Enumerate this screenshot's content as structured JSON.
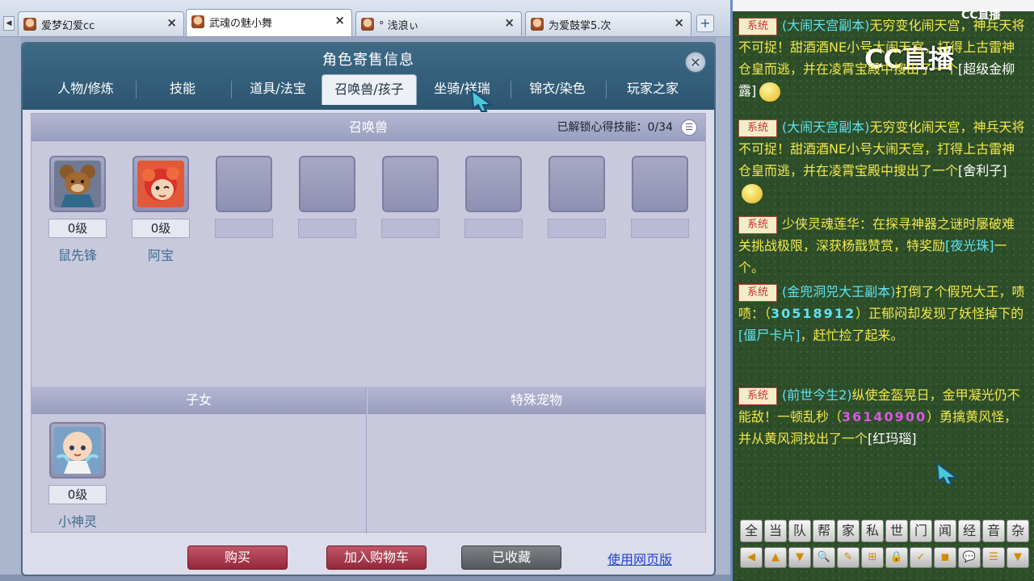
{
  "browser": {
    "tabs": [
      {
        "label": "爱梦幻爱cc",
        "close": "×"
      },
      {
        "label": "武魂の魅小舞",
        "close": "×"
      },
      {
        "label": "°  浅浪ぃ",
        "close": "×"
      },
      {
        "label": "为爱鼓掌5.次",
        "close": "×"
      }
    ],
    "add_tab": "+",
    "scroll_left": "◀"
  },
  "dialog": {
    "title": "角色寄售信息",
    "close": "✕",
    "tabs": [
      "人物/修炼",
      "技能",
      "道具/法宝",
      "召唤兽/孩子",
      "坐骑/祥瑞",
      "锦衣/染色",
      "玩家之家"
    ],
    "active_tab": "召唤兽/孩子",
    "summon_section": {
      "title": "召唤兽",
      "unlock_label": "已解锁心得技能：",
      "unlock_value": "0/34",
      "pets": [
        {
          "level": "0级",
          "name": "鼠先锋"
        },
        {
          "level": "0级",
          "name": "阿宝"
        }
      ],
      "empty_slots": 6
    },
    "children_section": {
      "title": "子女",
      "children": [
        {
          "level": "0级",
          "name": "小神灵"
        }
      ]
    },
    "special_section": {
      "title": "特殊宠物"
    },
    "buttons": {
      "buy": "购买",
      "add_cart": "加入购物车",
      "favorited": "已收藏",
      "web_version": "使用网页版"
    }
  },
  "chat": {
    "watermark_small": "CC直播",
    "watermark_big": "CC直播",
    "sys_tag": "系统",
    "messages": [
      {
        "parts": [
          {
            "t": "(大闹天宫副本)",
            "c": "cyan"
          },
          {
            "t": "无穷变化闹天宫，神兵天将不可捉！甜酒酒NE小号大闹天宫，打得上古雷神仓皇而逃，并在凌霄宝殿中搜出了一个",
            "c": ""
          },
          {
            "t": "[超级金柳露]",
            "c": "white"
          }
        ]
      },
      {
        "parts": [
          {
            "t": "(大闹天宫副本)",
            "c": "cyan"
          },
          {
            "t": "无穷变化闹天宫，神兵天将不可捉！甜酒酒NE小号大闹天宫，打得上古雷神仓皇而逃，并在凌霄宝殿中搜出了一个",
            "c": ""
          },
          {
            "t": "[舍利子]",
            "c": "white"
          }
        ]
      },
      {
        "parts": [
          {
            "t": "少侠灵魂莲华：在探寻神器之谜时屡破难关挑战极限，深获杨戬赞赏，特奖励",
            "c": ""
          },
          {
            "t": "[夜光珠]",
            "c": "cyan"
          },
          {
            "t": "一个。",
            "c": ""
          }
        ]
      },
      {
        "parts": [
          {
            "t": "(金兜洞兕大王副本)",
            "c": "cyan"
          },
          {
            "t": "打倒了个假兕大王，啧啧：（",
            "c": ""
          },
          {
            "t": "30518912",
            "c": "num"
          },
          {
            "t": "）正郁闷却发现了妖怪掉下的",
            "c": ""
          },
          {
            "t": "[僵尸卡片]",
            "c": "cyan"
          },
          {
            "t": "，赶忙捡了起来。",
            "c": ""
          }
        ]
      },
      {
        "parts": [
          {
            "t": "(前世今生2)",
            "c": "cyan"
          },
          {
            "t": "纵使金盔晃日，金甲凝光仍不能敌！一顿乱秒（",
            "c": ""
          },
          {
            "t": "36140900",
            "c": "num"
          },
          {
            "t": "）勇擒黄风怪，并从黄风洞找出了一个",
            "c": ""
          },
          {
            "t": "[红玛瑙]",
            "c": "white"
          }
        ]
      }
    ],
    "channels": [
      "全",
      "当",
      "队",
      "帮",
      "家",
      "私",
      "世",
      "门",
      "闻",
      "经",
      "音",
      "杂"
    ],
    "tools": [
      "◀",
      "▲",
      "▼",
      "🔍",
      "✎",
      "⊞",
      "🔒",
      "✓",
      "◼",
      "💬",
      "☰",
      "▼"
    ]
  }
}
